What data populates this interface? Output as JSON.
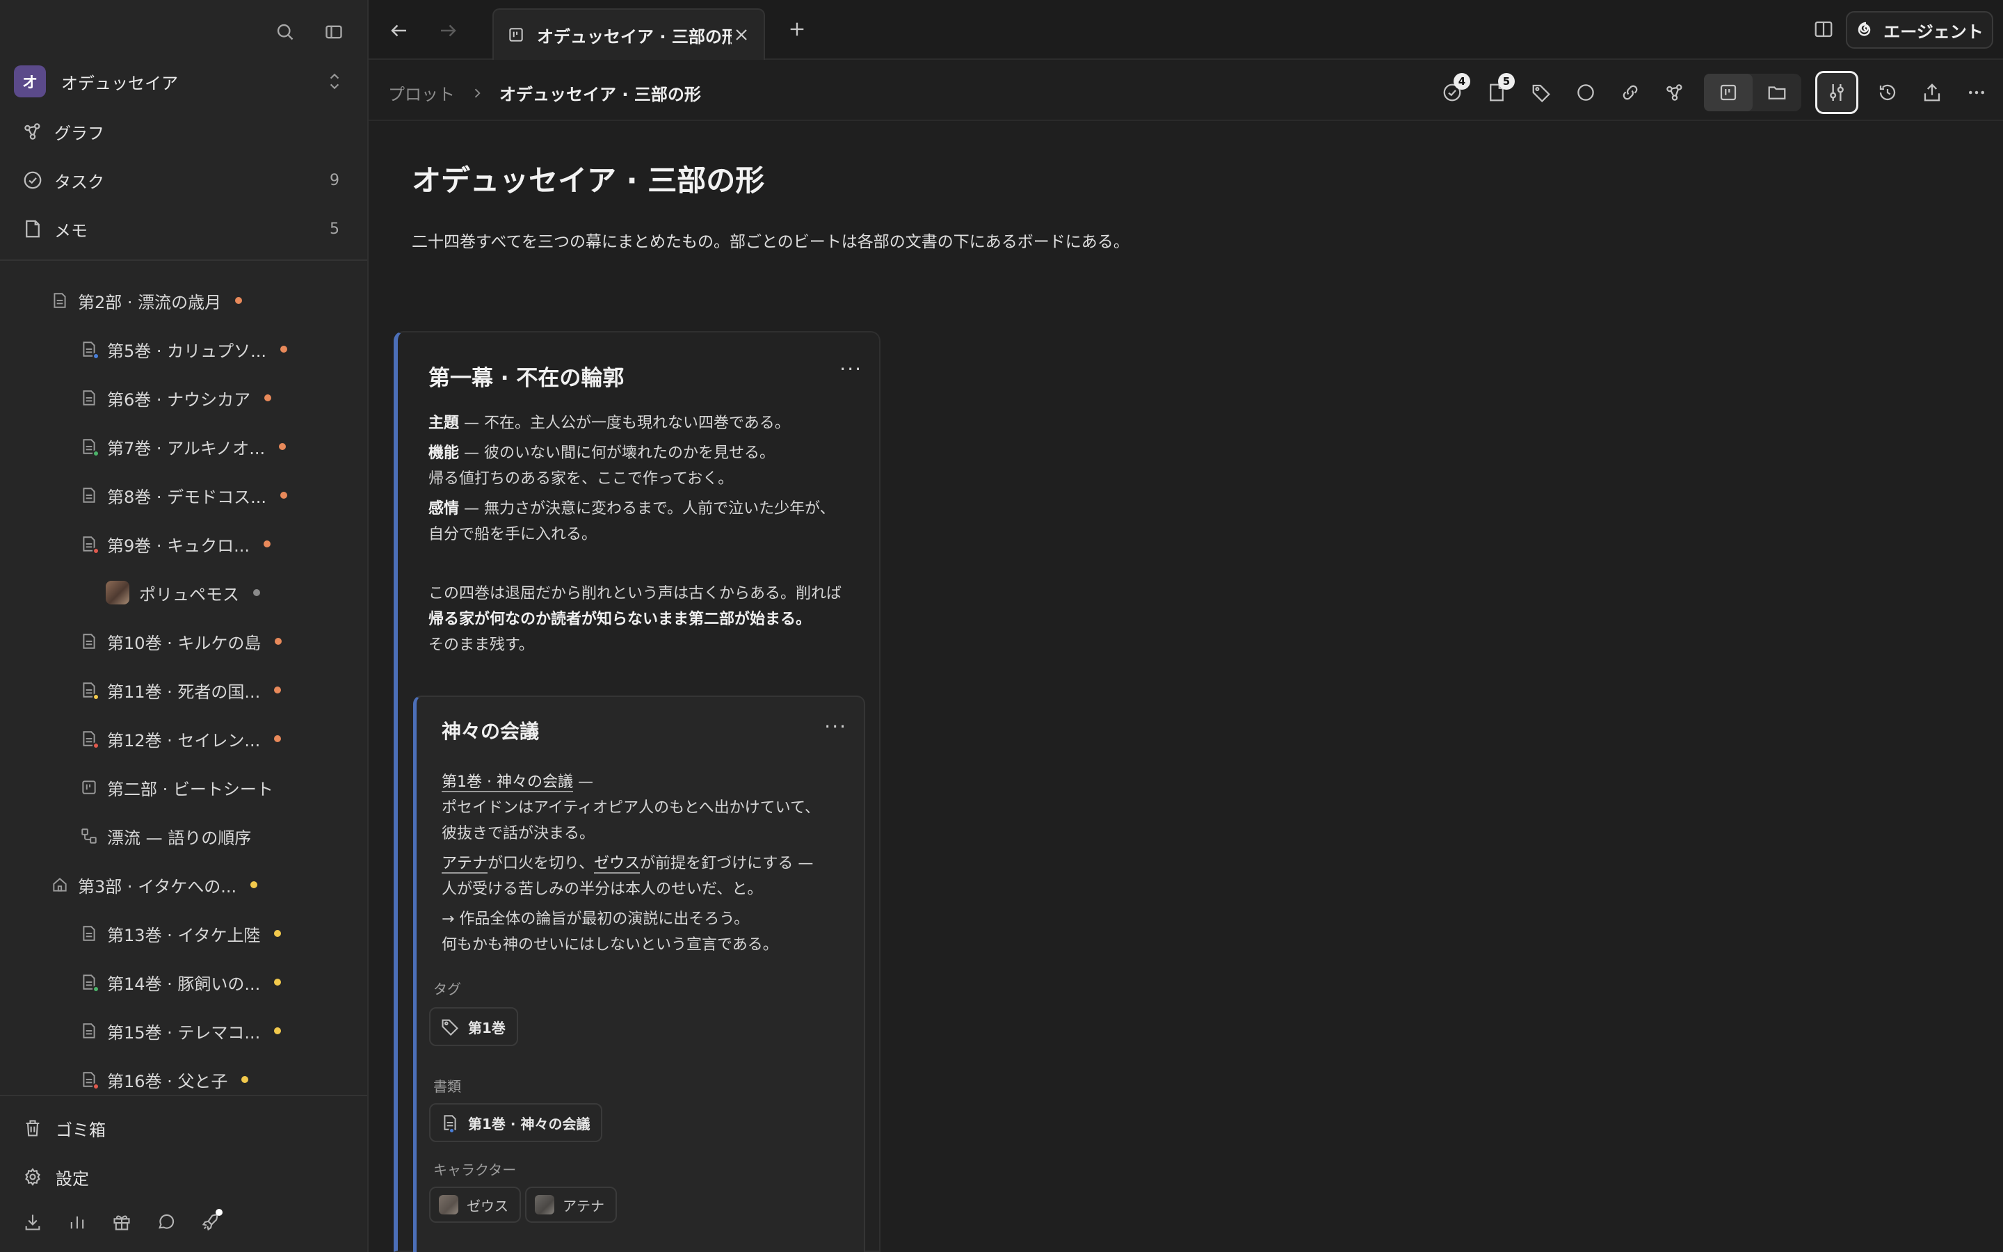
{
  "sidebar": {
    "workspace": {
      "initial": "オ",
      "name": "オデュッセイア"
    },
    "nav": [
      {
        "label": "グラフ",
        "count": ""
      },
      {
        "label": "タスク",
        "count": "9"
      },
      {
        "label": "メモ",
        "count": "5"
      }
    ],
    "tree": [
      {
        "label": "第2部 · 漂流の歳月"
      },
      {
        "label": "第5巻 · カリュプソ..."
      },
      {
        "label": "第6巻 · ナウシカア"
      },
      {
        "label": "第7巻 · アルキノオ..."
      },
      {
        "label": "第8巻 · デモドコス..."
      },
      {
        "label": "第9巻 · キュクロ..."
      },
      {
        "label": "ポリュペモス"
      },
      {
        "label": "第10巻 · キルケの島"
      },
      {
        "label": "第11巻 · 死者の国..."
      },
      {
        "label": "第12巻 · セイレン..."
      },
      {
        "label": "第二部 · ビートシート"
      },
      {
        "label": "漂流 — 語りの順序"
      },
      {
        "label": "第3部 · イタケへの..."
      },
      {
        "label": "第13巻 · イタケ上陸"
      },
      {
        "label": "第14巻 · 豚飼いの..."
      },
      {
        "label": "第15巻 · テレマコ..."
      },
      {
        "label": "第16巻 · 父と子"
      }
    ],
    "bottom": [
      {
        "label": "ゴミ箱"
      },
      {
        "label": "設定"
      }
    ],
    "colors": {
      "orange": "#e8895a",
      "yellow": "#f2c94c",
      "gray": "#8a8a8a",
      "blue": "#4a7fd8",
      "green": "#4cb36a",
      "red": "#e05a4e"
    }
  },
  "tabbar": {
    "tab_label": "オデュッセイア · 三部の形",
    "agent_label": "エージェント"
  },
  "breadcrumb": {
    "parent": "プロット",
    "current": "オデュッセイア · 三部の形"
  },
  "toolbar": {
    "tasks_badge": "4",
    "notes_badge": "5"
  },
  "document": {
    "title": "オデュッセイア · 三部の形",
    "description": "二十四巻すべてを三つの幕にまとめたもの。部ごとのビートは各部の文書の下にあるボードにある。"
  },
  "act_card": {
    "title": "第一幕 · 不在の輪郭",
    "more": "···",
    "theme_label": "主題",
    "theme_text": " — 不在。主人公が一度も現れない四巻である。",
    "function_label": "機能",
    "function_text_1": " — 彼のいない間に何が壊れたのかを見せる。",
    "function_text_2": "帰る値打ちのある家を、ここで作っておく。",
    "emotion_label": "感情",
    "emotion_text_1": " — 無力さが決意に変わるまで。人前で泣いた少年が、",
    "emotion_text_2": "自分で船を手に入れる。",
    "note_1": "この四巻は退屈だから削れという声は古くからある。削れば",
    "note_2": "帰る家が何なのか読者が知らないまま第二部が始まる。",
    "note_3": "そのまま残す。"
  },
  "beat_card": {
    "title": "神々の会議",
    "more": "···",
    "line1_link": "第1巻 · 神々の会議",
    "line1_rest": " —",
    "line2": "ポセイドンはアイティオピア人のもとへ出かけていて、",
    "line3": "彼抜きで話が決まる。",
    "line4_link_a": "アテナ",
    "line4_mid": "が口火を切り、",
    "line4_link_b": "ゼウス",
    "line4_rest": "が前提を釘づけにする —",
    "line5": "人が受ける苦しみの半分は本人のせいだ、と。",
    "line6": "→ 作品全体の論旨が最初の演説に出そろう。",
    "line7": "何もかも神のせいにはしないという宣言である。",
    "tags_label": "タグ",
    "tag": "第1巻",
    "docs_label": "書類",
    "doc": "第1巻 · 神々の会議",
    "chars_label": "キャラクター",
    "char_1": "ゼウス",
    "char_2": "アテナ"
  }
}
